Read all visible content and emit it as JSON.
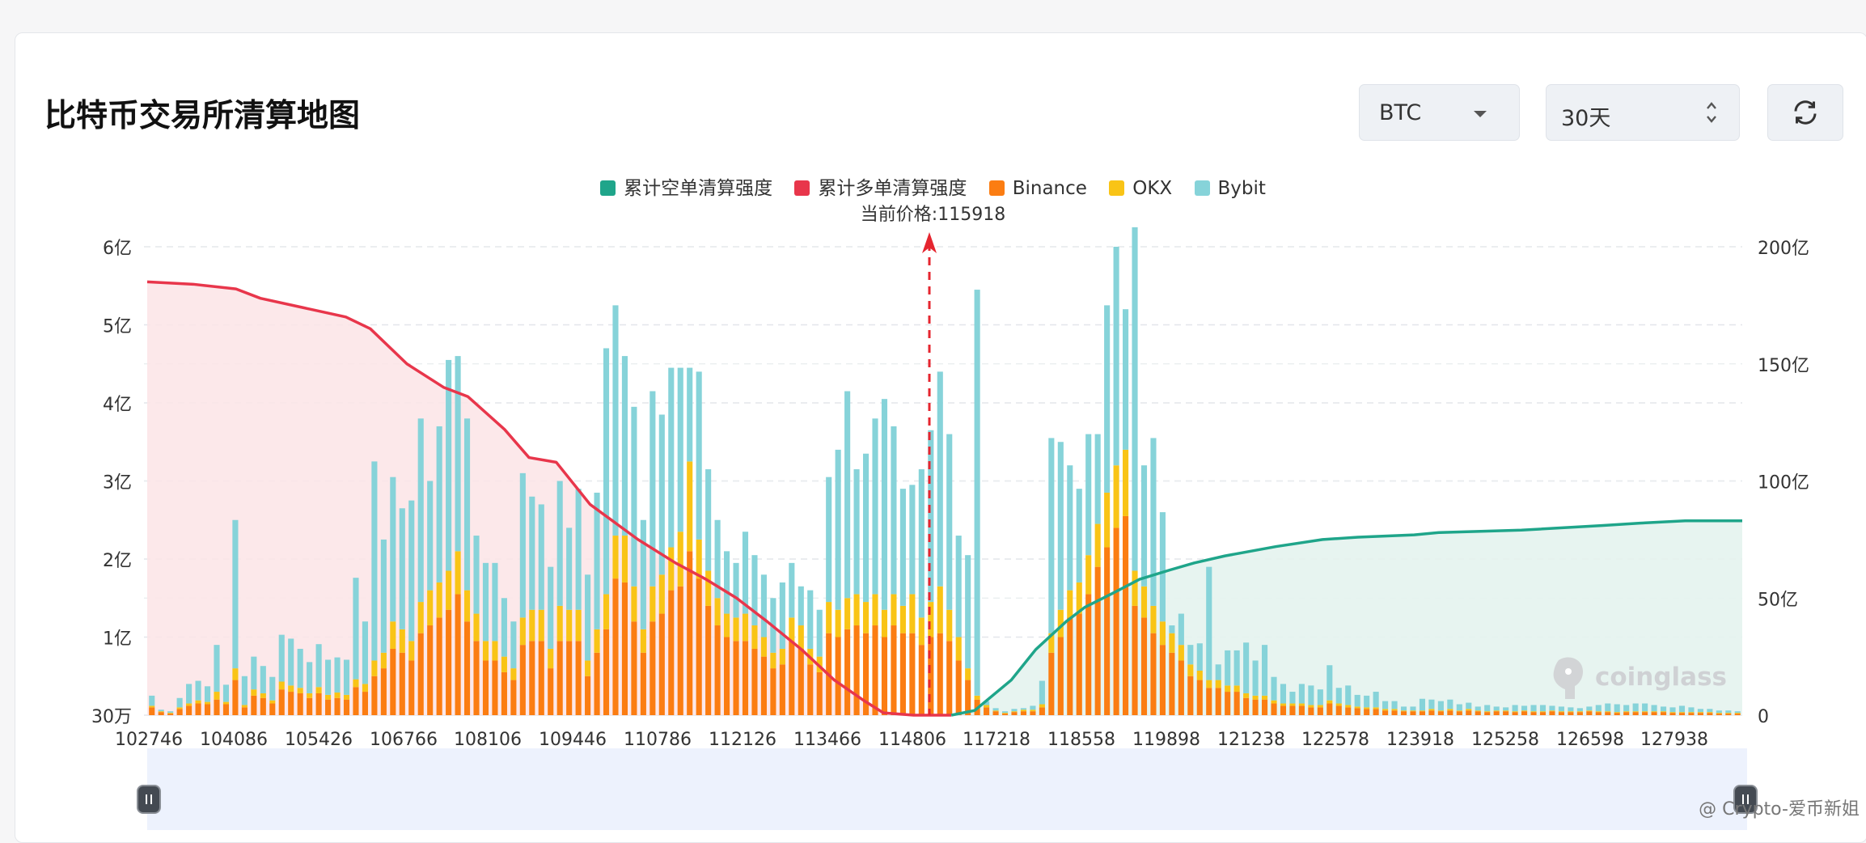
{
  "title": "比特币交易所清算地图",
  "controls": {
    "symbol": "BTC",
    "range": "30天"
  },
  "icons": {
    "symbol_dropdown": "caret-down-icon",
    "range_dropdown": "updown-arrows-icon",
    "refresh": "refresh-icon",
    "watermark": "coinglass-logo"
  },
  "watermark_text": "coinglass",
  "footer_credit": "@ Crypto-爱币新姐",
  "legend": [
    {
      "label": "累计空单清算强度",
      "color": "#1fa58a"
    },
    {
      "label": "累计多单清算强度",
      "color": "#e8364b"
    },
    {
      "label": "Binance",
      "color": "#fb7d12"
    },
    {
      "label": "OKX",
      "color": "#f9c416"
    },
    {
      "label": "Bybit",
      "color": "#86d3d9"
    }
  ],
  "current_price_label": "当前价格:115918",
  "chart_data": {
    "type": "bar",
    "current_price": 115918,
    "x_ticks": [
      "102746",
      "104086",
      "105426",
      "106766",
      "108106",
      "109446",
      "110786",
      "112126",
      "113466",
      "114806",
      "117218",
      "118558",
      "119898",
      "121238",
      "122578",
      "123918",
      "125258",
      "126598",
      "127938"
    ],
    "y_left": {
      "ticks": [
        "30万",
        "1亿",
        "2亿",
        "3亿",
        "4亿",
        "5亿",
        "6亿"
      ],
      "unit": "亿",
      "range": [
        0,
        6
      ]
    },
    "y_right": {
      "ticks": [
        "0",
        "50亿",
        "100亿",
        "150亿",
        "200亿"
      ],
      "unit": "亿",
      "range": [
        0,
        200
      ]
    },
    "grid": true,
    "legend_position": "top-center",
    "price_min": 102746,
    "price_max": 128874,
    "binance": [
      0.1,
      0.04,
      0.02,
      0.08,
      0.12,
      0.15,
      0.14,
      0.2,
      0.14,
      0.45,
      0.1,
      0.25,
      0.22,
      0.15,
      0.33,
      0.3,
      0.28,
      0.22,
      0.28,
      0.2,
      0.22,
      0.2,
      0.36,
      0.3,
      0.5,
      0.6,
      0.85,
      0.8,
      0.7,
      1.05,
      1.15,
      1.25,
      1.35,
      1.55,
      1.2,
      0.95,
      0.7,
      0.7,
      0.55,
      0.45,
      0.9,
      0.95,
      0.95,
      0.6,
      0.95,
      0.95,
      0.95,
      0.5,
      0.8,
      1.1,
      1.75,
      1.7,
      1.2,
      0.8,
      1.2,
      1.3,
      1.6,
      1.65,
      2.1,
      1.75,
      1.4,
      1.15,
      1.0,
      0.95,
      0.95,
      0.85,
      0.75,
      0.6,
      0.65,
      0.95,
      0.85,
      0.65,
      0.55,
      1.05,
      1.0,
      1.1,
      1.15,
      1.05,
      1.15,
      1.0,
      1.15,
      1.05,
      1.05,
      0.9,
      1.0,
      1.05,
      0.95,
      0.7,
      0.45,
      0.2,
      0.1,
      0.05,
      0.02,
      0.04,
      0.05,
      0.05,
      0.1,
      0.8,
      1.0,
      1.25,
      1.3,
      1.55,
      1.9,
      2.15,
      2.4,
      2.55,
      1.4,
      1.25,
      1.05,
      0.9,
      0.8,
      0.7,
      0.5,
      0.45,
      0.35,
      0.35,
      0.3,
      0.3,
      0.22,
      0.2,
      0.2,
      0.15,
      0.12,
      0.12,
      0.12,
      0.1,
      0.1,
      0.15,
      0.12,
      0.1,
      0.09,
      0.08,
      0.08,
      0.06,
      0.06,
      0.05,
      0.05,
      0.05,
      0.06,
      0.05,
      0.06,
      0.05,
      0.06,
      0.05,
      0.04,
      0.05,
      0.05,
      0.04,
      0.05,
      0.04,
      0.04,
      0.05,
      0.04,
      0.04,
      0.04,
      0.05,
      0.04,
      0.04,
      0.03,
      0.04,
      0.04,
      0.04,
      0.04,
      0.04,
      0.03,
      0.03,
      0.03,
      0.03,
      0.03,
      0.02,
      0.02,
      0.02
    ],
    "okx": [
      0.02,
      0.01,
      0.01,
      0.02,
      0.03,
      0.04,
      0.03,
      0.1,
      0.03,
      0.15,
      0.03,
      0.08,
      0.06,
      0.04,
      0.1,
      0.08,
      0.07,
      0.06,
      0.08,
      0.06,
      0.07,
      0.06,
      0.1,
      0.1,
      0.2,
      0.2,
      0.35,
      0.3,
      0.25,
      0.4,
      0.45,
      0.45,
      0.5,
      0.55,
      0.4,
      0.35,
      0.25,
      0.25,
      0.2,
      0.15,
      0.35,
      0.4,
      0.4,
      0.25,
      0.45,
      0.4,
      0.4,
      0.2,
      0.3,
      0.45,
      0.55,
      0.6,
      0.45,
      0.3,
      0.45,
      0.5,
      0.55,
      0.7,
      1.15,
      0.5,
      0.45,
      0.35,
      0.3,
      0.3,
      0.35,
      0.3,
      0.25,
      0.2,
      0.2,
      0.3,
      0.3,
      0.2,
      0.2,
      0.4,
      0.35,
      0.4,
      0.4,
      0.4,
      0.4,
      0.35,
      0.4,
      0.35,
      0.5,
      0.35,
      0.45,
      0.6,
      0.4,
      0.3,
      0.15,
      0.05,
      0.03,
      0.01,
      0.01,
      0.01,
      0.02,
      0.02,
      0.04,
      0.25,
      0.35,
      0.35,
      0.4,
      0.5,
      0.55,
      0.7,
      0.8,
      0.85,
      0.45,
      0.4,
      0.35,
      0.3,
      0.25,
      0.2,
      0.15,
      0.12,
      0.1,
      0.1,
      0.08,
      0.08,
      0.06,
      0.05,
      0.05,
      0.04,
      0.03,
      0.03,
      0.03,
      0.03,
      0.03,
      0.04,
      0.03,
      0.03,
      0.02,
      0.02,
      0.02,
      0.02,
      0.02,
      0.01,
      0.01,
      0.01,
      0.02,
      0.01,
      0.02,
      0.01,
      0.02,
      0.01,
      0.01,
      0.01,
      0.01,
      0.01,
      0.01,
      0.01,
      0.01,
      0.01,
      0.01,
      0.01,
      0.01,
      0.01,
      0.01,
      0.01,
      0.01,
      0.01,
      0.01,
      0.01,
      0.01,
      0.01,
      0.01,
      0.01,
      0.01,
      0.01,
      0.01,
      0.01,
      0.01,
      0.01
    ],
    "bybit": [
      0.13,
      0.02,
      0.02,
      0.12,
      0.25,
      0.25,
      0.2,
      0.6,
      0.22,
      1.9,
      0.37,
      0.42,
      0.35,
      0.3,
      0.6,
      0.6,
      0.5,
      0.4,
      0.55,
      0.45,
      0.45,
      0.45,
      1.3,
      0.8,
      2.55,
      1.45,
      1.85,
      1.55,
      1.8,
      2.35,
      1.4,
      2.0,
      2.7,
      2.5,
      2.2,
      1.0,
      1.0,
      1.0,
      0.75,
      0.6,
      1.85,
      1.45,
      1.35,
      1.05,
      1.6,
      1.05,
      1.55,
      1.1,
      1.75,
      3.15,
      2.95,
      2.3,
      2.3,
      1.4,
      2.5,
      2.05,
      2.3,
      2.1,
      1.2,
      2.15,
      1.3,
      1.0,
      0.8,
      0.7,
      1.05,
      0.9,
      0.8,
      0.7,
      0.85,
      0.7,
      0.5,
      0.75,
      0.6,
      1.6,
      2.05,
      2.65,
      1.6,
      1.9,
      2.25,
      2.7,
      2.15,
      1.5,
      1.4,
      1.9,
      2.2,
      2.75,
      2.25,
      1.3,
      1.45,
      5.2,
      0.05,
      0.03,
      0.02,
      0.03,
      0.02,
      0.05,
      0.3,
      2.5,
      2.15,
      1.6,
      1.2,
      1.55,
      1.15,
      2.4,
      2.8,
      1.8,
      4.4,
      1.55,
      2.15,
      1.4,
      0.1,
      0.4,
      0.25,
      0.35,
      1.45,
      0.2,
      0.45,
      0.45,
      0.65,
      0.45,
      0.65,
      0.3,
      0.25,
      0.15,
      0.25,
      0.25,
      0.2,
      0.45,
      0.2,
      0.25,
      0.15,
      0.15,
      0.2,
      0.1,
      0.1,
      0.05,
      0.05,
      0.15,
      0.12,
      0.12,
      0.12,
      0.08,
      0.08,
      0.05,
      0.08,
      0.05,
      0.04,
      0.08,
      0.06,
      0.08,
      0.08,
      0.06,
      0.06,
      0.05,
      0.04,
      0.05,
      0.08,
      0.1,
      0.1,
      0.08,
      0.1,
      0.1,
      0.08,
      0.06,
      0.06,
      0.08,
      0.06,
      0.04,
      0.04,
      0.03,
      0.03,
      0.02
    ],
    "cum_long_points": [
      [
        102746,
        185
      ],
      [
        103500,
        184
      ],
      [
        104200,
        182
      ],
      [
        104600,
        178
      ],
      [
        105300,
        174
      ],
      [
        106000,
        170
      ],
      [
        106400,
        165
      ],
      [
        107000,
        150
      ],
      [
        107600,
        140
      ],
      [
        108000,
        136
      ],
      [
        108600,
        122
      ],
      [
        109000,
        110
      ],
      [
        109446,
        108
      ],
      [
        110000,
        90
      ],
      [
        110786,
        75
      ],
      [
        111400,
        65
      ],
      [
        111900,
        58
      ],
      [
        112400,
        50
      ],
      [
        112900,
        40
      ],
      [
        113466,
        28
      ],
      [
        114000,
        15
      ],
      [
        114500,
        6
      ],
      [
        114806,
        1
      ],
      [
        115300,
        0
      ],
      [
        115918,
        0
      ]
    ],
    "cum_short_points": [
      [
        115918,
        0
      ],
      [
        116300,
        2
      ],
      [
        116900,
        15
      ],
      [
        117300,
        28
      ],
      [
        117800,
        40
      ],
      [
        118100,
        46
      ],
      [
        118558,
        52
      ],
      [
        119000,
        58
      ],
      [
        119500,
        62
      ],
      [
        119898,
        65
      ],
      [
        120400,
        68
      ],
      [
        121238,
        72
      ],
      [
        122000,
        75
      ],
      [
        122578,
        76
      ],
      [
        123500,
        77
      ],
      [
        123918,
        78
      ],
      [
        125258,
        79
      ],
      [
        126598,
        81
      ],
      [
        127200,
        82
      ],
      [
        127938,
        83
      ],
      [
        128874,
        83
      ]
    ]
  }
}
